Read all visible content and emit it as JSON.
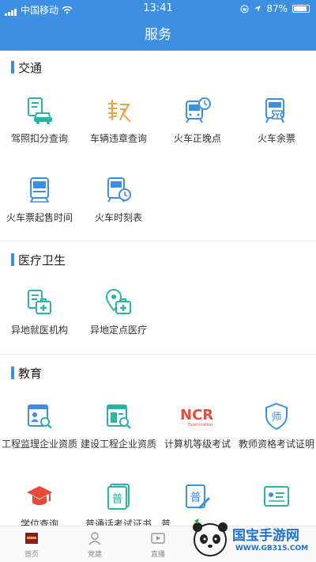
{
  "status_bar": {
    "carrier": "中国移动",
    "time": "13:41",
    "battery": "87%"
  },
  "header": {
    "title": "服务"
  },
  "sections": {
    "traffic": {
      "title": "交通",
      "items": [
        {
          "label": "驾照扣分查询",
          "icon": "driving-license-car-icon"
        },
        {
          "label": "车辆违章查询",
          "icon": "violation-icon"
        },
        {
          "label": "火车正晚点",
          "icon": "train-clock-icon"
        },
        {
          "label": "火车余票",
          "icon": "train-ticket-icon"
        },
        {
          "label": "火车票起售时间",
          "icon": "train-icon"
        },
        {
          "label": "火车时刻表",
          "icon": "train-schedule-icon"
        }
      ]
    },
    "medical": {
      "title": "医疗卫生",
      "items": [
        {
          "label": "异地就医机构",
          "icon": "medical-institution-icon"
        },
        {
          "label": "异地定点医疗",
          "icon": "medical-location-icon"
        }
      ]
    },
    "education": {
      "title": "教育",
      "items": [
        {
          "label": "工程监理企业资质",
          "icon": "engineering-supervision-icon"
        },
        {
          "label": "建设工程企业资质",
          "icon": "construction-enterprise-icon"
        },
        {
          "label": "计算机等级考试",
          "icon": "ncre-logo-icon"
        },
        {
          "label": "教师资格考试证明",
          "icon": "teacher-shield-icon"
        },
        {
          "label": "学位查询",
          "icon": "graduation-cap-icon"
        },
        {
          "label": "普通话考试证书",
          "icon": "mandarin-certificate-icon"
        },
        {
          "label": "普",
          "icon": "mandarin-pen-icon"
        },
        {
          "label": "",
          "icon": "certificate-icon"
        }
      ],
      "logo_text": {
        "ncre": "NCR",
        "ncre_sub": "Examination",
        "pu": "普",
        "shi": "师"
      }
    }
  },
  "tabbar": {
    "items": [
      {
        "label": "首页",
        "icon": "home-icon"
      },
      {
        "label": "党建",
        "icon": "party-building-icon"
      },
      {
        "label": "直播",
        "icon": "live-play-icon"
      }
    ]
  },
  "watermark": {
    "brand": "国宝手游网",
    "url": "WWW.GB315.COM"
  },
  "colors": {
    "primary": "#3d8fe3",
    "teal": "#2ab3a6",
    "orange": "#f0a040",
    "red": "#e84a3c"
  }
}
